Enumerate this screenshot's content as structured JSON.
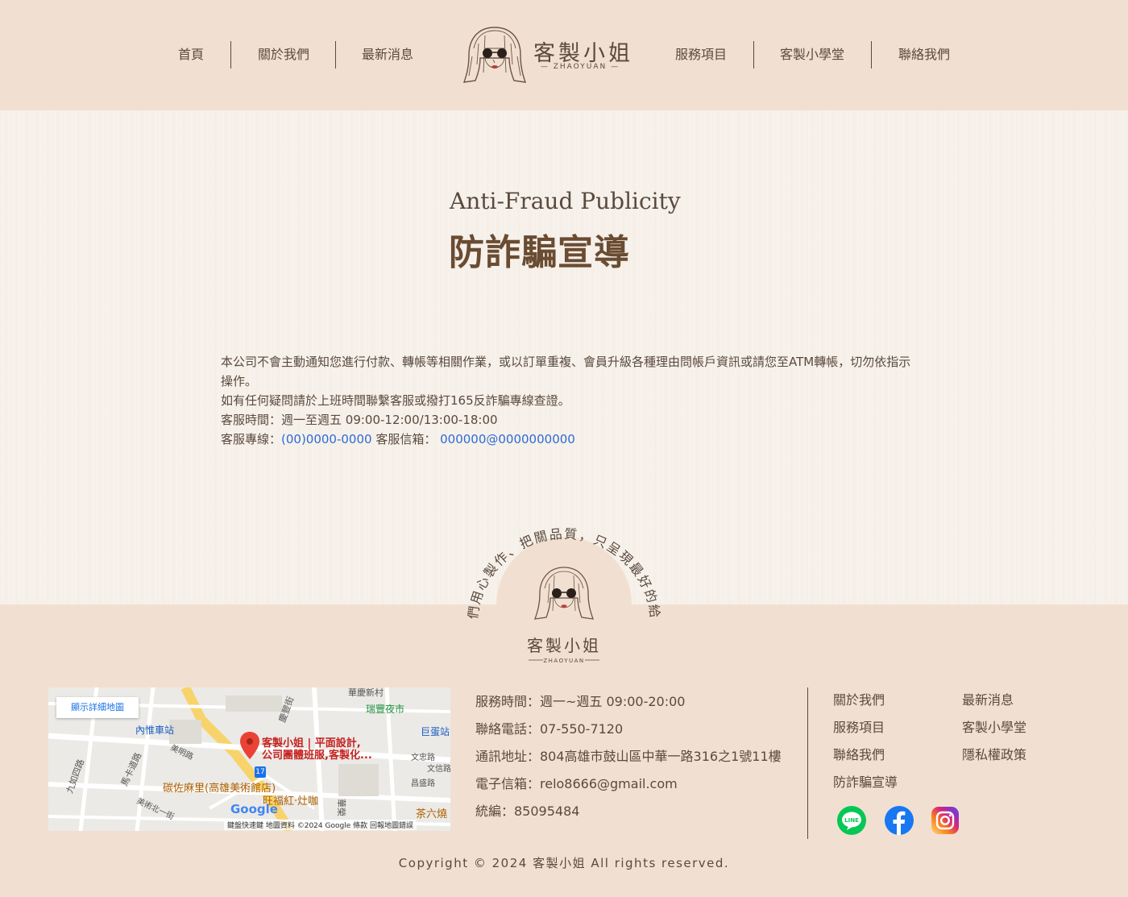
{
  "nav": {
    "left": [
      "首頁",
      "關於我們",
      "最新消息"
    ],
    "right": [
      "服務項目",
      "客製小學堂",
      "聯絡我們"
    ]
  },
  "logo": {
    "name": "客製小姐",
    "sub": "ZHAOYUAN"
  },
  "page": {
    "title_en": "Anti-Fraud Publicity",
    "title_zh": "防詐騙宣導"
  },
  "notice": {
    "line1": "本公司不會主動通知您進行付款、轉帳等相關作業，或以訂單重複、會員升級各種理由問帳戶資訊或請您至ATM轉帳，切勿依指示操作。",
    "line2": "如有任何疑問請於上班時間聯繫客服或撥打165反詐騙專線查證。",
    "line3": "客服時間：週一至週五 09:00-12:00/13:00-18:00",
    "hotline_label": "客服專線：",
    "hotline": "(00)0000-0000",
    "email_label": " 客服信箱： ",
    "email": "000000@0000000000"
  },
  "badge": {
    "slogan": "我們用心製作、把關品質，只呈現最好的給你",
    "name": "客製小姐",
    "sub": "ZHAOYUAN"
  },
  "map": {
    "button": "顯示詳細地圖",
    "place_line1": "客製小姐 | 平面設計,",
    "place_line2": "公司團體班服,客製化...",
    "labels": [
      "內惟車站",
      "瑞豐夜市",
      "巨蛋站",
      "碳佐麻里(高雄美術館店)",
      "旺福紅·灶咖",
      "茶六燒",
      "九如四路",
      "馬卡道路",
      "美術北一街",
      "美明路",
      "慶豐街",
      "華慶新村",
      "文忠路",
      "昌盛路",
      "文信路",
      "華榮"
    ],
    "google": "Google",
    "attribution": "鍵盤快速鍵   地圖資料 ©2024 Google   條款   回報地圖錯誤",
    "route": "17"
  },
  "footer_info": {
    "hours": "服務時間：週一~週五 09:00-20:00",
    "phone": "聯絡電話：07-550-7120",
    "address": "通訊地址：804高雄市鼓山區中華一路316之1號11樓",
    "email": "電子信箱：relo8666@gmail.com",
    "tax_id": "統編：85095484"
  },
  "footer_links": {
    "col1": [
      "關於我們",
      "服務項目",
      "聯絡我們",
      "防詐騙宣導"
    ],
    "col2": [
      "最新消息",
      "客製小學堂",
      "隱私權政策"
    ]
  },
  "social": {
    "line_label": "LINE",
    "line_color": "#06c755",
    "facebook_color": "#1877f2",
    "instagram_colors": [
      "#feda75",
      "#d62976",
      "#962fbf",
      "#4f5bd5"
    ]
  },
  "copyright": "Copyright © 2024 客製小姐 All rights reserved.",
  "colors": {
    "header_bg": "#f1e0d1",
    "text": "#5a4a3e",
    "title": "#6a4c32",
    "link": "#2d6bd6"
  }
}
